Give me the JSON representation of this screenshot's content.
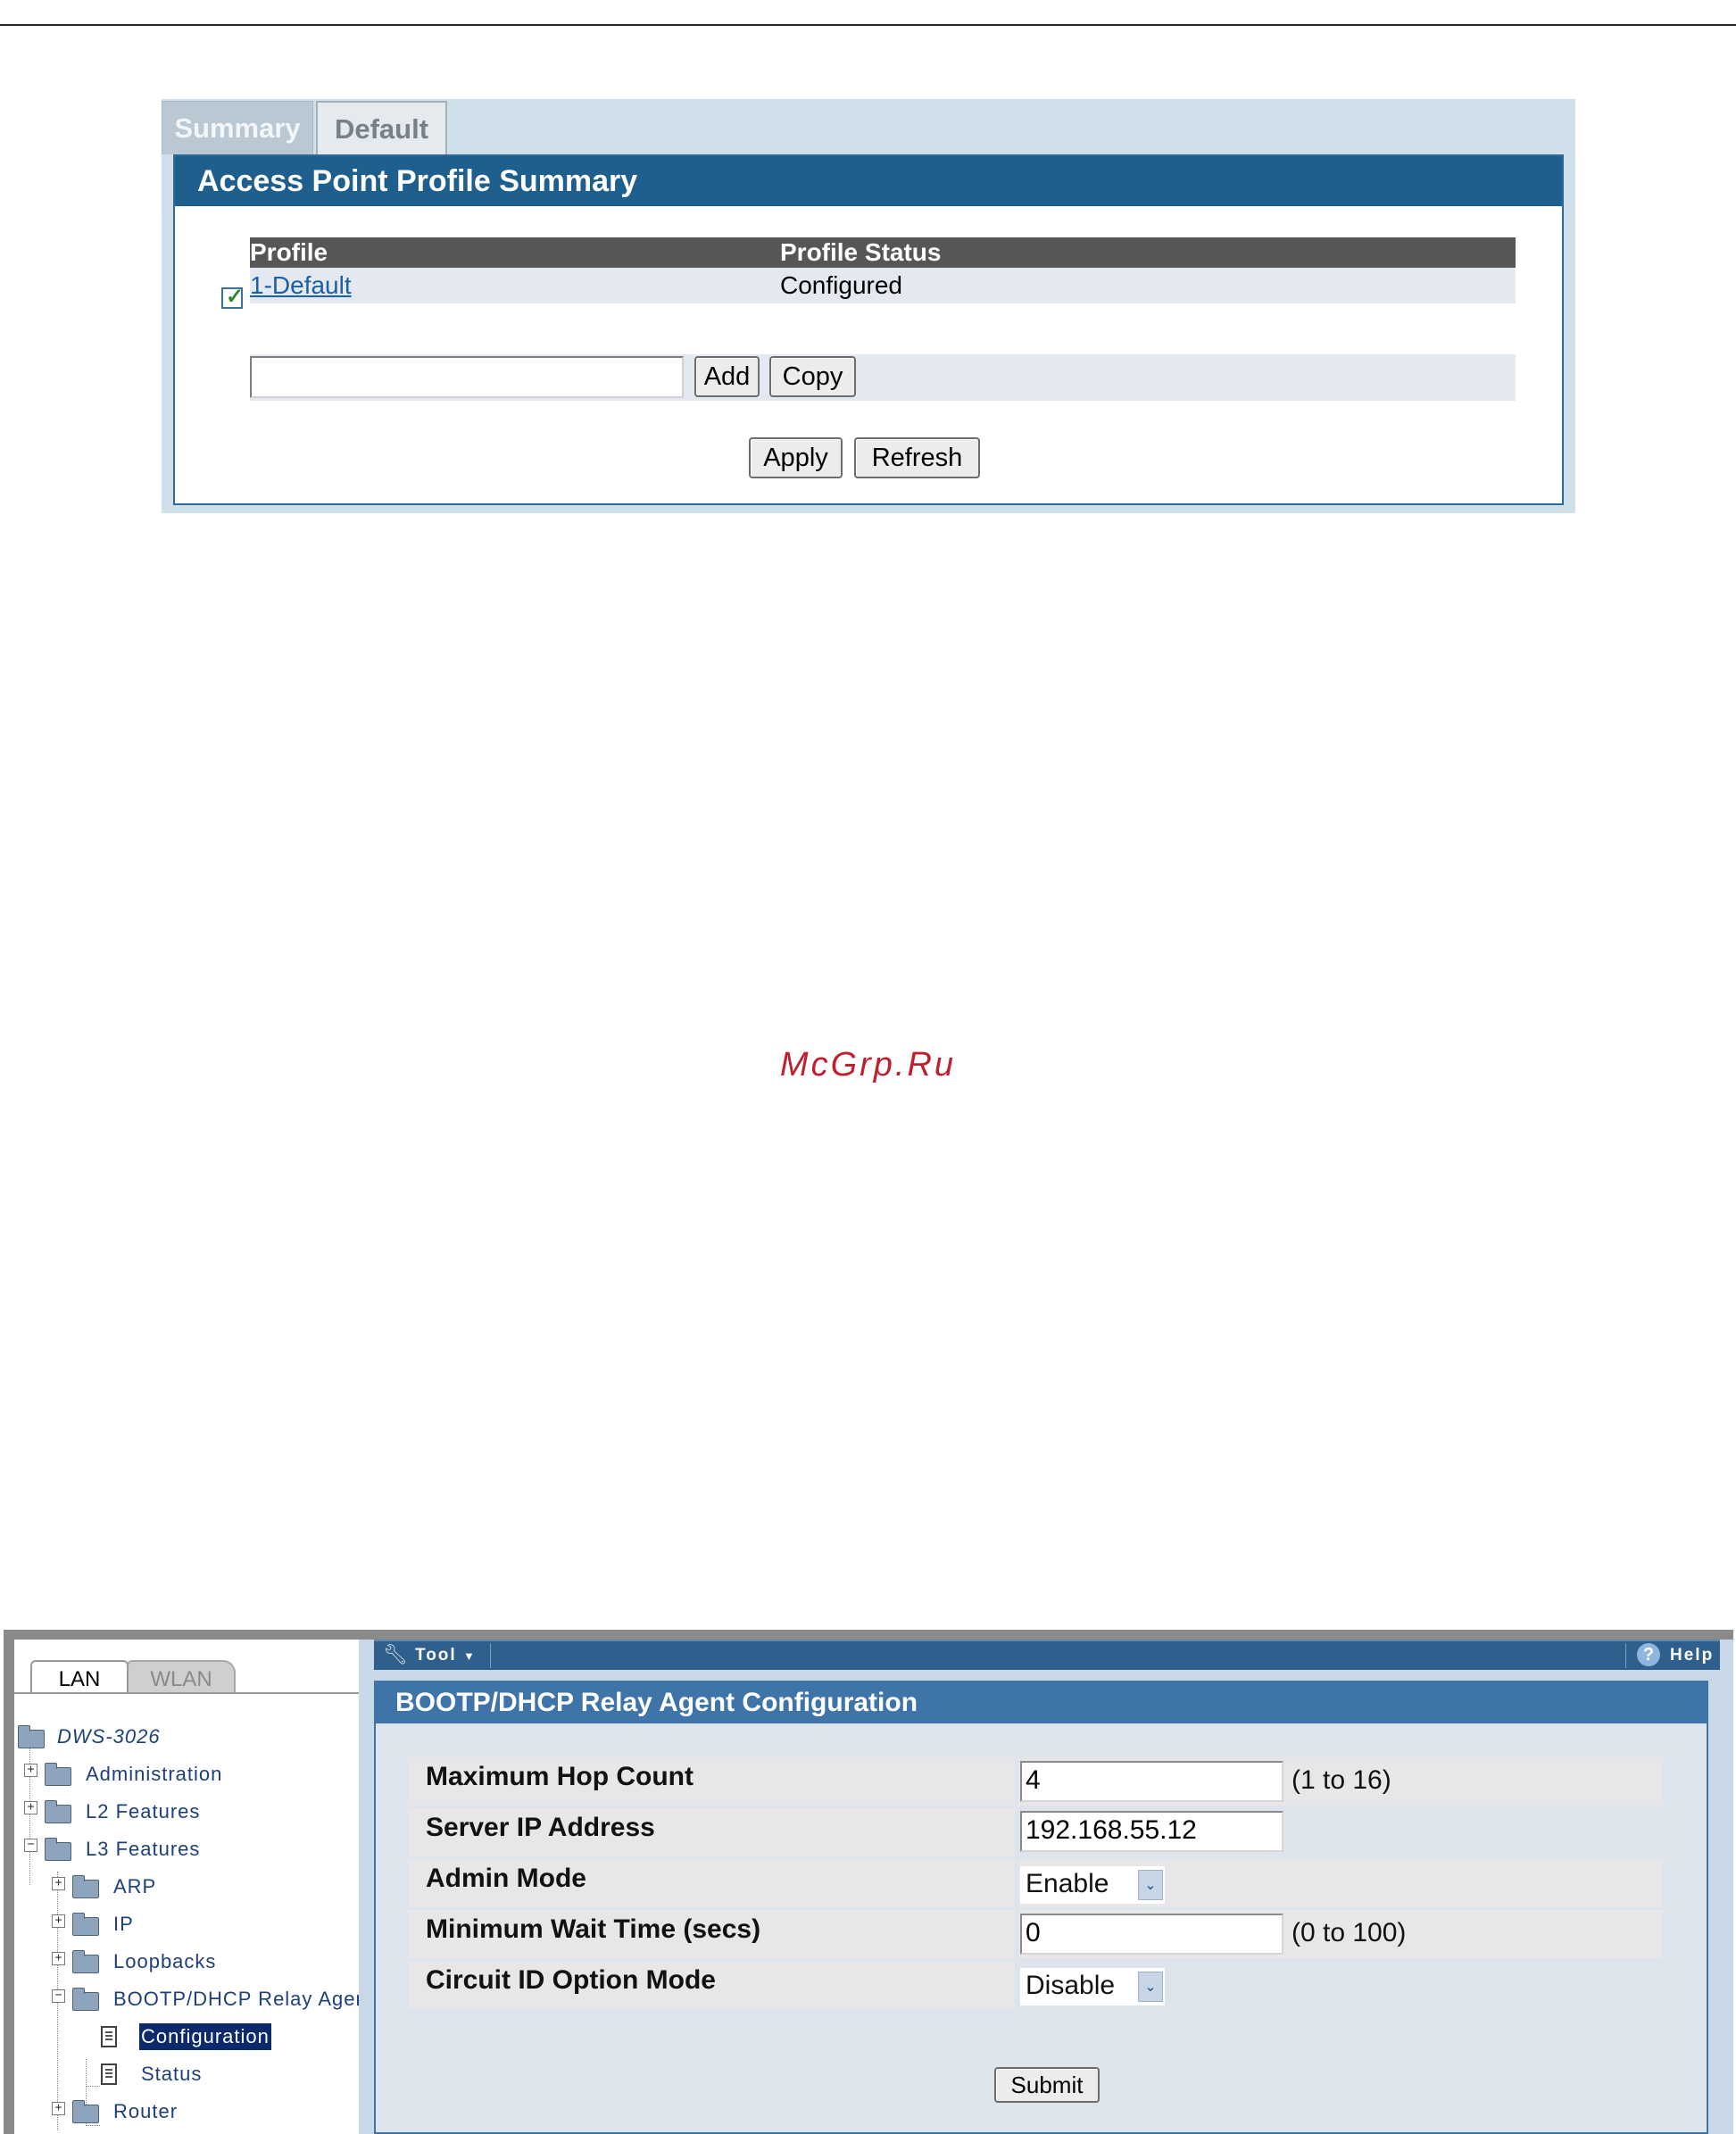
{
  "profile_ui": {
    "tabs": [
      "Summary",
      "Default"
    ],
    "panel_title": "Access Point Profile Summary",
    "columns": [
      "Profile",
      "Profile Status"
    ],
    "rows": [
      {
        "profile": "1-Default",
        "status": "Configured",
        "checked": true
      }
    ],
    "new_profile_value": "",
    "buttons": {
      "add": "Add",
      "copy": "Copy",
      "apply": "Apply",
      "refresh": "Refresh"
    }
  },
  "watermark": "McGrp.Ru",
  "relay_ui": {
    "nav_tabs": [
      "LAN",
      "WLAN"
    ],
    "tree": [
      {
        "label": "DWS-3026",
        "level": 0,
        "type": "root"
      },
      {
        "label": "Administration",
        "level": 1,
        "type": "folder",
        "expander": "+"
      },
      {
        "label": "L2 Features",
        "level": 1,
        "type": "folder",
        "expander": "+"
      },
      {
        "label": "L3 Features",
        "level": 1,
        "type": "folder-open",
        "expander": "-"
      },
      {
        "label": "ARP",
        "level": 2,
        "type": "folder",
        "expander": "+"
      },
      {
        "label": "IP",
        "level": 2,
        "type": "folder",
        "expander": "+"
      },
      {
        "label": "Loopbacks",
        "level": 2,
        "type": "folder",
        "expander": "+"
      },
      {
        "label": "BOOTP/DHCP Relay Ager",
        "level": 2,
        "type": "folder-open",
        "expander": "-"
      },
      {
        "label": "Configuration",
        "level": 3,
        "type": "page",
        "selected": true
      },
      {
        "label": "Status",
        "level": 3,
        "type": "page"
      },
      {
        "label": "Router",
        "level": 2,
        "type": "folder",
        "expander": "+"
      }
    ],
    "toolbar": {
      "tool_label": "Tool",
      "help_label": "Help"
    },
    "panel_title": "BOOTP/DHCP Relay Agent Configuration",
    "fields": {
      "max_hop": {
        "label": "Maximum Hop Count",
        "value": "4",
        "range": "(1 to 16)"
      },
      "server_ip": {
        "label": "Server IP Address",
        "value": "192.168.55.12"
      },
      "admin_mode": {
        "label": "Admin Mode",
        "value": "Enable"
      },
      "min_wait": {
        "label": "Minimum Wait Time (secs)",
        "value": "0",
        "range": "(0 to 100)"
      },
      "circuit_id": {
        "label": "Circuit ID Option Mode",
        "value": "Disable"
      }
    },
    "submit_label": "Submit"
  }
}
